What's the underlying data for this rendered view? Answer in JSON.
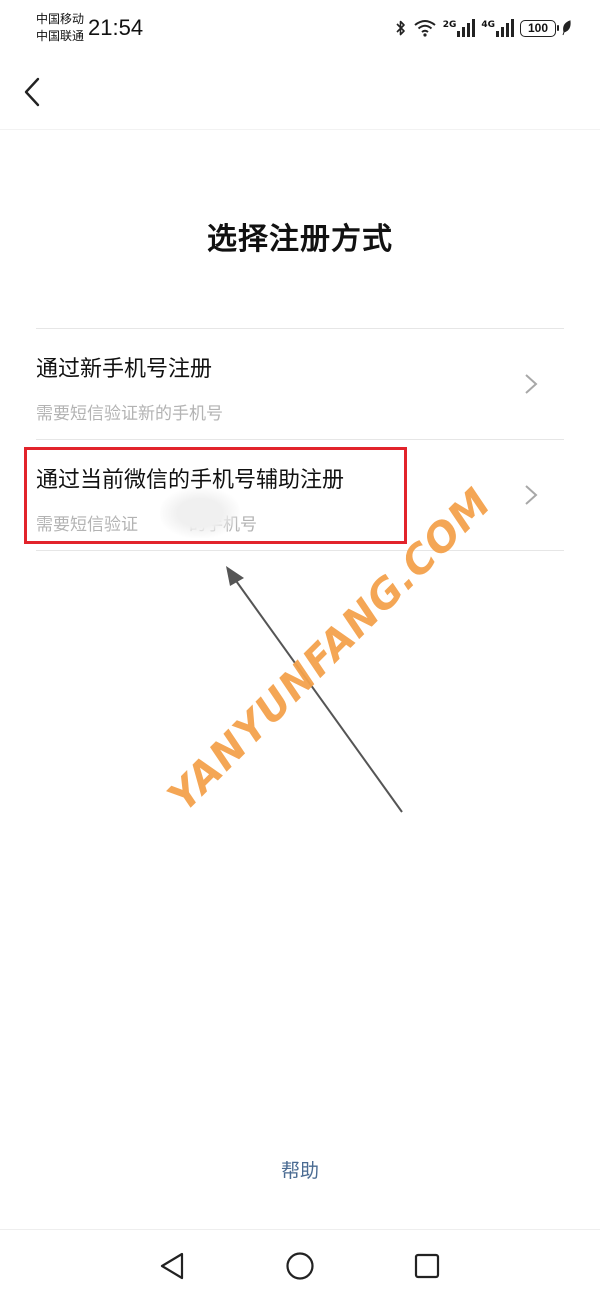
{
  "status_bar": {
    "carrier_1": "中国移动",
    "carrier_2": "中国联通",
    "time": "21:54",
    "network_1": "2G",
    "network_2": "4G",
    "battery": "100"
  },
  "page": {
    "title": "选择注册方式"
  },
  "options": [
    {
      "title": "通过新手机号注册",
      "subtitle": "需要短信验证新的手机号"
    },
    {
      "title": "通过当前微信的手机号辅助注册",
      "subtitle": "需要短信验证　　　的手机号"
    }
  ],
  "watermark": "YANYUNFANG.COM",
  "help": "帮助",
  "colors": {
    "highlight": "#e2232b",
    "link": "#4a6b92",
    "watermark": "#f4a24c"
  },
  "icons": [
    "back-arrow-icon",
    "chevron-right-icon",
    "bluetooth-icon",
    "wifi-icon",
    "signal-icon",
    "leaf-icon",
    "nav-back-icon",
    "nav-home-icon",
    "nav-recents-icon"
  ]
}
